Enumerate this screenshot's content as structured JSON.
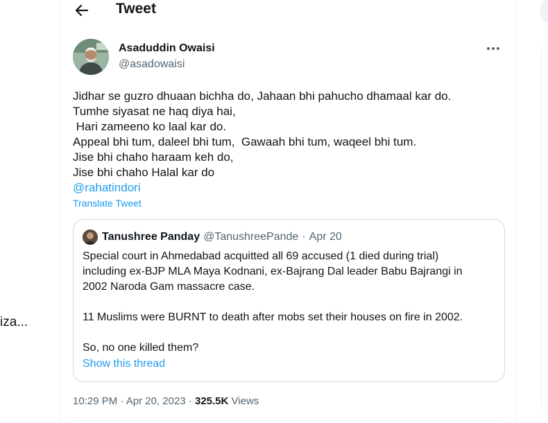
{
  "left": {
    "truncated_text": "iza..."
  },
  "header": {
    "back_icon": "arrow-left-icon",
    "title": "Tweet"
  },
  "author": {
    "name": "Asaduddin Owaisi",
    "handle": "@asadowaisi",
    "more_icon": "more-horizontal-icon"
  },
  "tweet": {
    "lines": [
      "Jidhar se guzro dhuaan bichha do, Jahaan bhi pahucho dhamaal kar do.",
      "Tumhe siyasat ne haq diya hai,",
      " Hari zameeno ko laal kar do.",
      "Appeal bhi tum, daleel bhi tum,  Gawaah bhi tum, waqeel bhi tum.",
      "Jise bhi chaho haraam keh do,",
      "Jise bhi chaho Halal kar do"
    ],
    "mention": "@rahatindori",
    "translate_label": "Translate Tweet"
  },
  "quote": {
    "name": "Tanushree Panday",
    "handle": "@TanushreePande",
    "separator": "·",
    "date": "Apr 20",
    "para1": [
      "Special court in Ahmedabad acquitted all 69 accused (1 died during trial)",
      "including ex-BJP MLA Maya Kodnani, ex-Bajrang Dal leader Babu Bajrangi in",
      "2002 Naroda Gam massacre case."
    ],
    "para2": "11 Muslims were BURNT to death after mobs set their houses on fire in 2002.",
    "para3": "So, no one killed them?",
    "show_thread": "Show this thread"
  },
  "meta": {
    "time": "10:29 PM",
    "sep1": "·",
    "date": "Apr 20, 2023",
    "sep2": "·",
    "views_count": "325.5K",
    "views_label": "Views"
  },
  "colors": {
    "link": "#1d9bf0",
    "secondary": "#536471",
    "text": "#0f1419",
    "border": "#cfd9de"
  }
}
